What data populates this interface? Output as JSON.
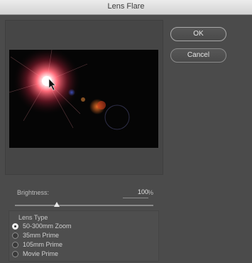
{
  "window": {
    "title": "Lens Flare"
  },
  "buttons": {
    "ok_label": "OK",
    "cancel_label": "Cancel"
  },
  "brightness": {
    "label": "Brightness:",
    "value": "100",
    "unit": "%",
    "slider_fraction": 0.3
  },
  "lens_type": {
    "title": "Lens Type",
    "options": [
      {
        "label": "50-300mm Zoom",
        "selected": true
      },
      {
        "label": "35mm Prime",
        "selected": false
      },
      {
        "label": "105mm Prime",
        "selected": false
      },
      {
        "label": "Movie Prime",
        "selected": false
      }
    ]
  },
  "colors": {
    "dialog_bg": "#4b4b4b",
    "flare_core": "#ffffff",
    "flare_glow": "#ff5a6a",
    "preview_bg": "#050505"
  }
}
